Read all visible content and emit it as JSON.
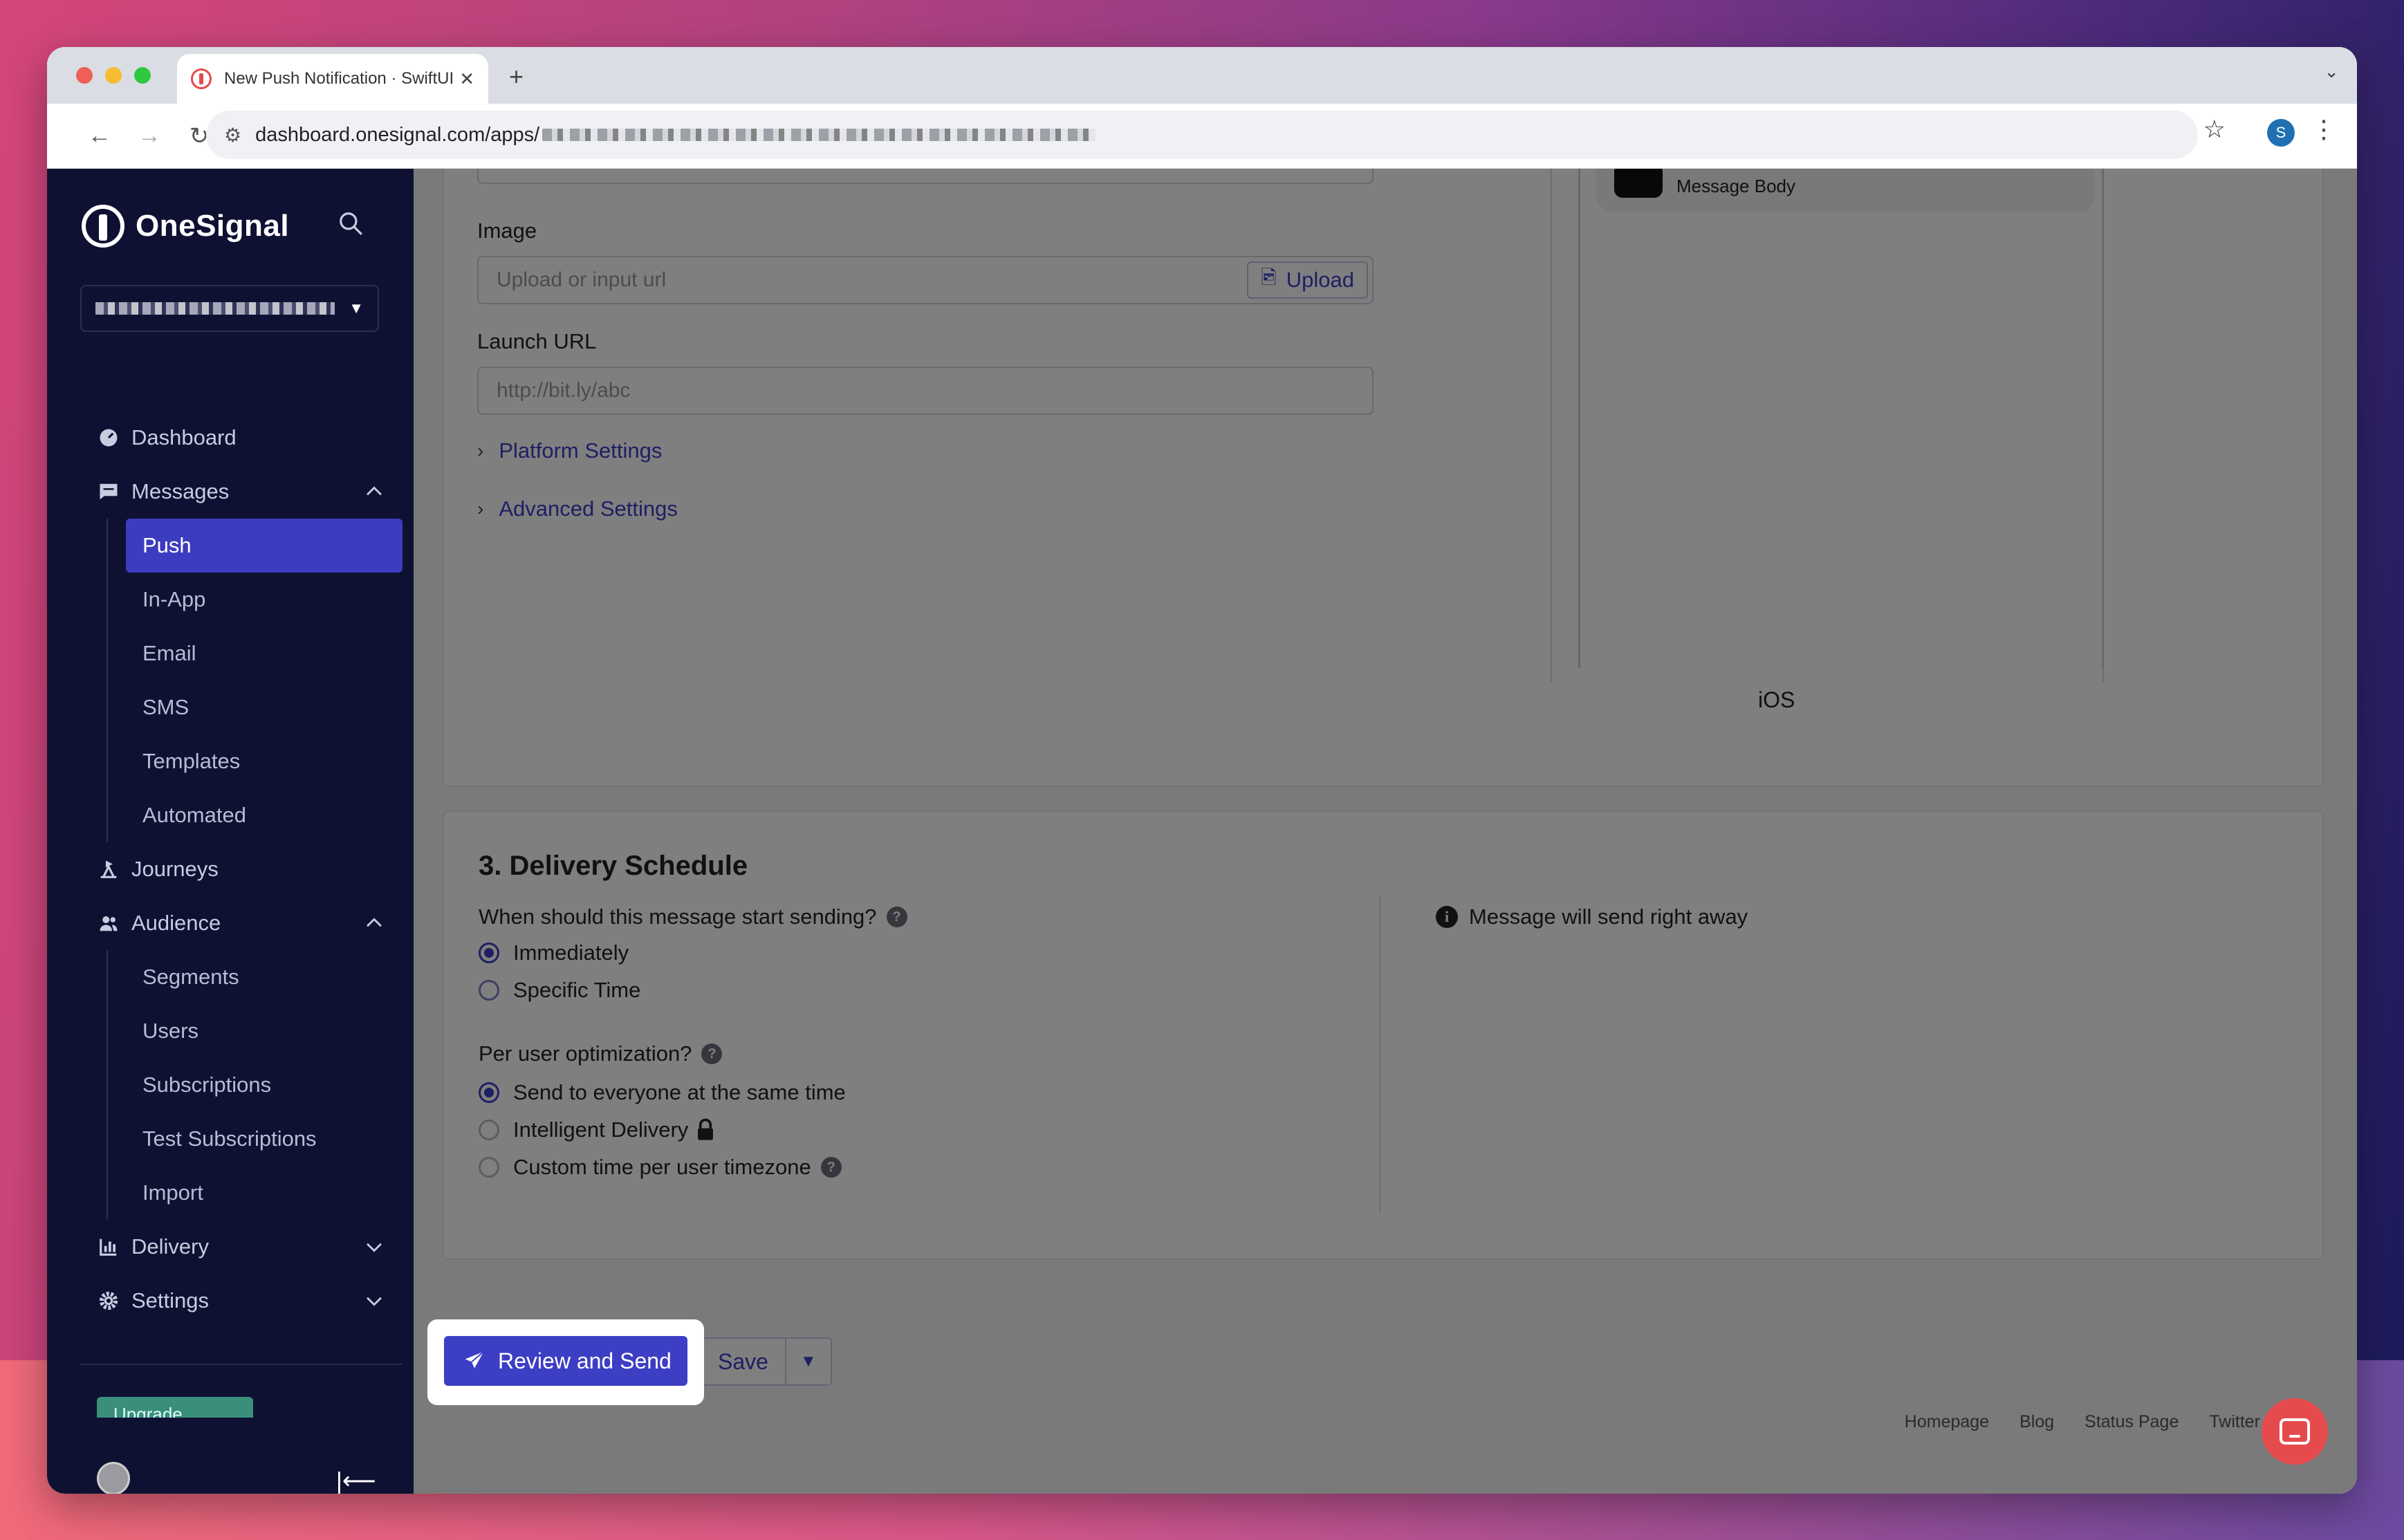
{
  "browser": {
    "tab_title": "New Push Notification · SwiftUI",
    "url_visible": "dashboard.onesignal.com/apps/",
    "profile_initial": "S"
  },
  "sidebar": {
    "brand": "OneSignal",
    "nav": [
      {
        "label": "Dashboard",
        "icon": "dashboard-icon"
      },
      {
        "label": "Messages",
        "icon": "messages-icon",
        "expanded": true,
        "children": [
          "Push",
          "In-App",
          "Email",
          "SMS",
          "Templates",
          "Automated"
        ],
        "active": "Push"
      },
      {
        "label": "Journeys",
        "icon": "journeys-icon"
      },
      {
        "label": "Audience",
        "icon": "audience-icon",
        "expanded": true,
        "children": [
          "Segments",
          "Users",
          "Subscriptions",
          "Test Subscriptions",
          "Import"
        ]
      },
      {
        "label": "Delivery",
        "icon": "delivery-icon",
        "expanded": false
      },
      {
        "label": "Settings",
        "icon": "settings-icon",
        "expanded": false
      }
    ],
    "upgrade_label": "Upgrade"
  },
  "form": {
    "image_label": "Image",
    "image_placeholder": "Upload or input url",
    "upload_label": "Upload",
    "launch_url_label": "Launch URL",
    "launch_url_placeholder": "http://bit.ly/abc",
    "platform_settings": "Platform Settings",
    "advanced_settings": "Advanced Settings"
  },
  "preview": {
    "notification_body": "Message Body",
    "platform": "iOS"
  },
  "delivery": {
    "title": "3. Delivery Schedule",
    "start_question": "When should this message start sending?",
    "start_options": [
      {
        "label": "Immediately",
        "selected": true
      },
      {
        "label": "Specific Time",
        "selected": false
      }
    ],
    "optimization_question": "Per user optimization?",
    "optimization_options": [
      {
        "label": "Send to everyone at the same time",
        "selected": true
      },
      {
        "label": "Intelligent Delivery",
        "selected": false,
        "locked": true
      },
      {
        "label": "Custom time per user timezone",
        "selected": false,
        "help": true
      }
    ],
    "info": "Message will send right away"
  },
  "actions": {
    "review_send": "Review and Send",
    "save": "Save"
  },
  "footer": [
    "Homepage",
    "Blog",
    "Status Page",
    "Twitter"
  ]
}
